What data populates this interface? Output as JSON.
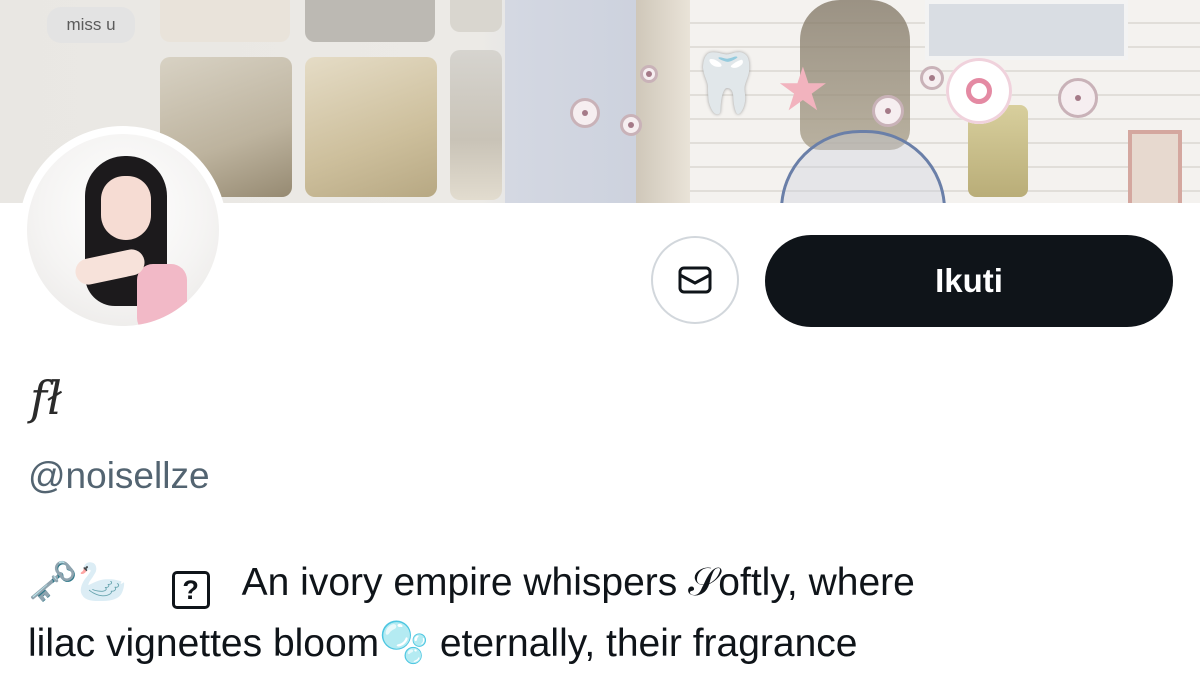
{
  "banner": {
    "chat_bubble_text": "miss u"
  },
  "profile": {
    "display_name": "fł",
    "handle": "@noisellze"
  },
  "actions": {
    "message_icon": "envelope-icon",
    "follow_label": "Ikuti"
  },
  "bio": {
    "emoji_key": "🗝️",
    "emoji_swan": "🦢",
    "unknown_glyph": "?",
    "line1_text": "An ivory empire whispers 𝒮oftly, where",
    "line2_start": "lilac vignettes bloom",
    "emoji_bubbles": "🫧",
    "line2_end": " eternally, their fragrance"
  },
  "colors": {
    "follow_button_bg": "#0f1419",
    "handle_text": "#536471"
  }
}
